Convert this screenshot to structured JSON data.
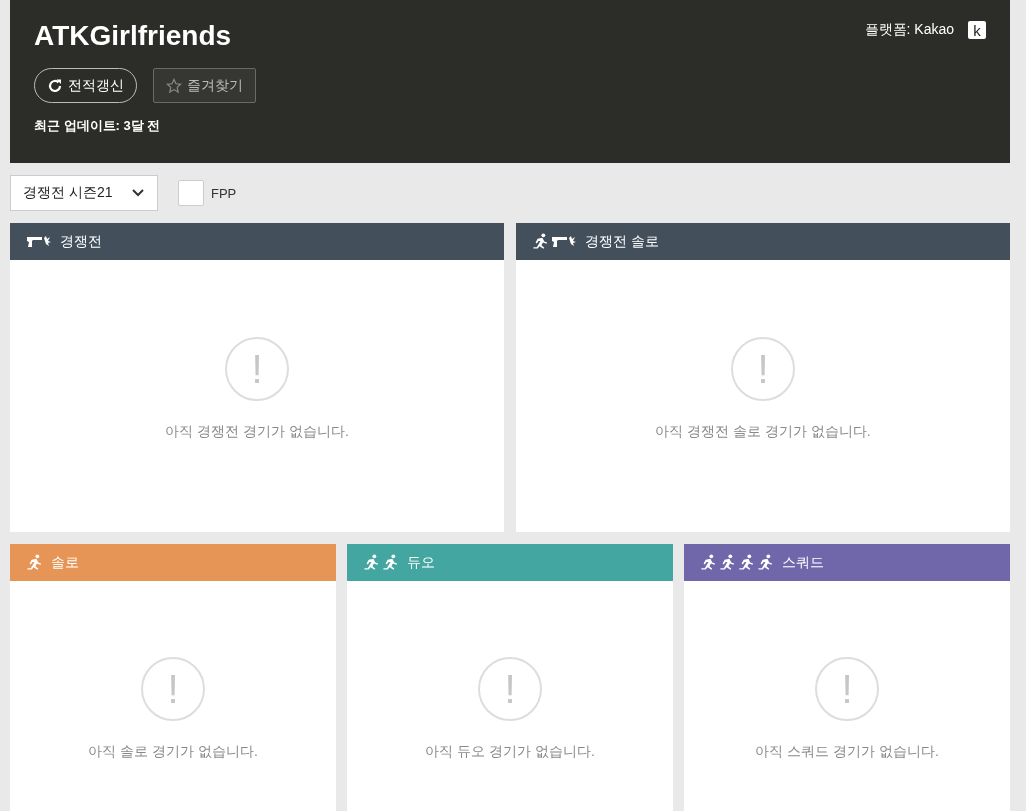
{
  "profile": {
    "name": "ATKGirlfriends",
    "platform": "플랫폼: Kakao",
    "platform_badge": "k",
    "refresh_button": "전적갱신",
    "favorite_button": "즐겨찾기",
    "last_update": "최근 업데이트: 3달 전"
  },
  "filters": {
    "season": "경쟁전 시즌21",
    "fpp": {
      "label": "FPP",
      "checked": false
    }
  },
  "panels": [
    {
      "title": "경쟁전",
      "color": "#434f5b",
      "icons": [
        {
          "kind": "gun"
        }
      ],
      "alert": "!",
      "message": "아직 경쟁전 경기가 없습니다."
    },
    {
      "title": "경쟁전 솔로",
      "color": "#434f5b",
      "icons": [
        {
          "kind": "runner"
        },
        {
          "kind": "gun"
        }
      ],
      "alert": "!",
      "message": "아직 경쟁전 솔로 경기가 없습니다."
    },
    {
      "title": "솔로",
      "color": "#e79556",
      "icons": [
        {
          "kind": "runner"
        }
      ],
      "alert": "!",
      "message": "아직 솔로 경기가 없습니다."
    },
    {
      "title": "듀오",
      "color": "#43a6a0",
      "icons": [
        {
          "kind": "runner"
        },
        {
          "kind": "runner"
        }
      ],
      "alert": "!",
      "message": "아직 듀오 경기가 없습니다."
    },
    {
      "title": "스쿼드",
      "color": "#6f67a9",
      "icons": [
        {
          "kind": "runner"
        },
        {
          "kind": "runner"
        },
        {
          "kind": "runner"
        },
        {
          "kind": "runner"
        }
      ],
      "alert": "!",
      "message": "아직 스쿼드 경기가 없습니다."
    }
  ]
}
